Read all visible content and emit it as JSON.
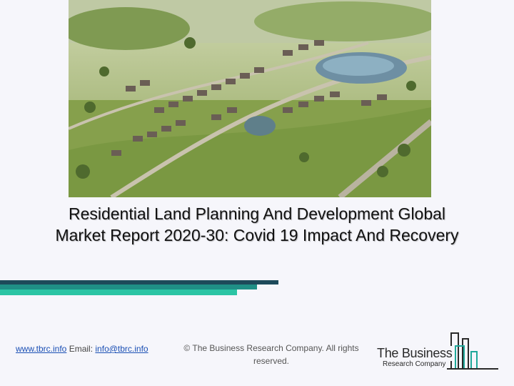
{
  "title": {
    "line1": "Residential Land Planning And Development Global",
    "line2": "Market Report 2020-30: Covid 19 Impact And Recovery"
  },
  "hero_image": {
    "subject": "aerial illustration of a residential land development"
  },
  "colors": {
    "bar_dark": "#1d4a5a",
    "bar_mid": "#1f8f86",
    "bar_light": "#2bc4a4",
    "link": "#1a4fb4",
    "logo_teal": "#1fa89a"
  },
  "footer": {
    "website": "www.tbrc.info",
    "email_label": "Email:",
    "email": "info@tbrc.info",
    "copyright": "© The Business Research Company. All rights reserved."
  },
  "logo": {
    "name": "The Business",
    "sub": "Research Company"
  }
}
